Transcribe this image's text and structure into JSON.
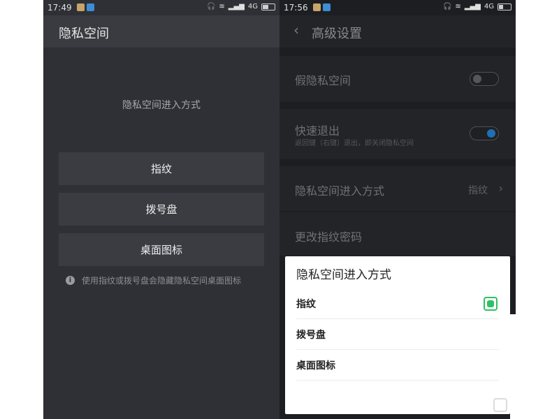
{
  "left": {
    "status": {
      "time": "17:49",
      "network": "4G"
    },
    "title": "隐私空间",
    "subtitle": "隐私空间进入方式",
    "options": [
      "指纹",
      "拨号盘",
      "桌面图标"
    ],
    "hint": "使用指纹或拨号盘会隐藏隐私空间桌面图标"
  },
  "right": {
    "status": {
      "time": "17:56",
      "network": "4G"
    },
    "title": "高级设置",
    "rows": {
      "fake_space": {
        "label": "假隐私空间",
        "enabled": false
      },
      "quick_exit": {
        "label": "快速退出",
        "sub": "返回键（右键）退出，即关闭隐私空间",
        "enabled": true
      },
      "entry_method": {
        "label": "隐私空间进入方式",
        "value": "指纹"
      },
      "change_password": {
        "label": "更改指纹密码"
      }
    }
  },
  "dialog": {
    "title": "隐私空间进入方式",
    "options": [
      {
        "label": "指纹",
        "selected": true
      },
      {
        "label": "拨号盘",
        "selected": false
      },
      {
        "label": "桌面图标",
        "selected": false
      }
    ]
  },
  "colors": {
    "accent_green": "#2fc064",
    "switch_on": "#1e6fb4",
    "dark_bg": "#2f3035"
  }
}
